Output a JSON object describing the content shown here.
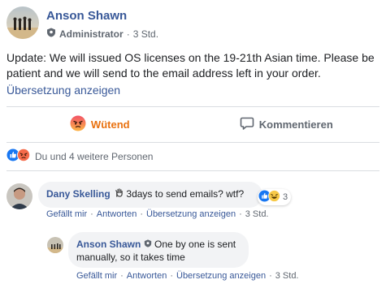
{
  "post": {
    "author": "Anson Shawn",
    "role": "Administrator",
    "time": "3 Std.",
    "text": "Update: We will issued OS licenses on the 19-21th Asian time. Please be patient and we will send to the email address left in your order.",
    "translate_link": "Übersetzung anzeigen"
  },
  "actions": {
    "react_label": "Wütend",
    "comment_label": "Kommentieren"
  },
  "reactions_summary": {
    "text": "Du und 4 weitere Personen",
    "icons": [
      "like-icon",
      "angry-icon"
    ]
  },
  "comments": [
    {
      "author": "Dany Skelling",
      "text": "3days to send emails? wtf?",
      "reaction_count": "3",
      "links": {
        "like": "Gefällt mir",
        "reply": "Antworten",
        "translate": "Übersetzung anzeigen",
        "time": "3 Std."
      }
    }
  ],
  "reply": {
    "author": "Anson Shawn",
    "text": "One by one is sent manually, so it takes time",
    "links": {
      "like": "Gefällt mir",
      "reply": "Antworten",
      "translate": "Übersetzung anzeigen",
      "time": "3 Std."
    }
  },
  "colors": {
    "link": "#385898",
    "angry": "#e9710f",
    "like": "#1877f2",
    "bubble": "#f2f3f5"
  }
}
